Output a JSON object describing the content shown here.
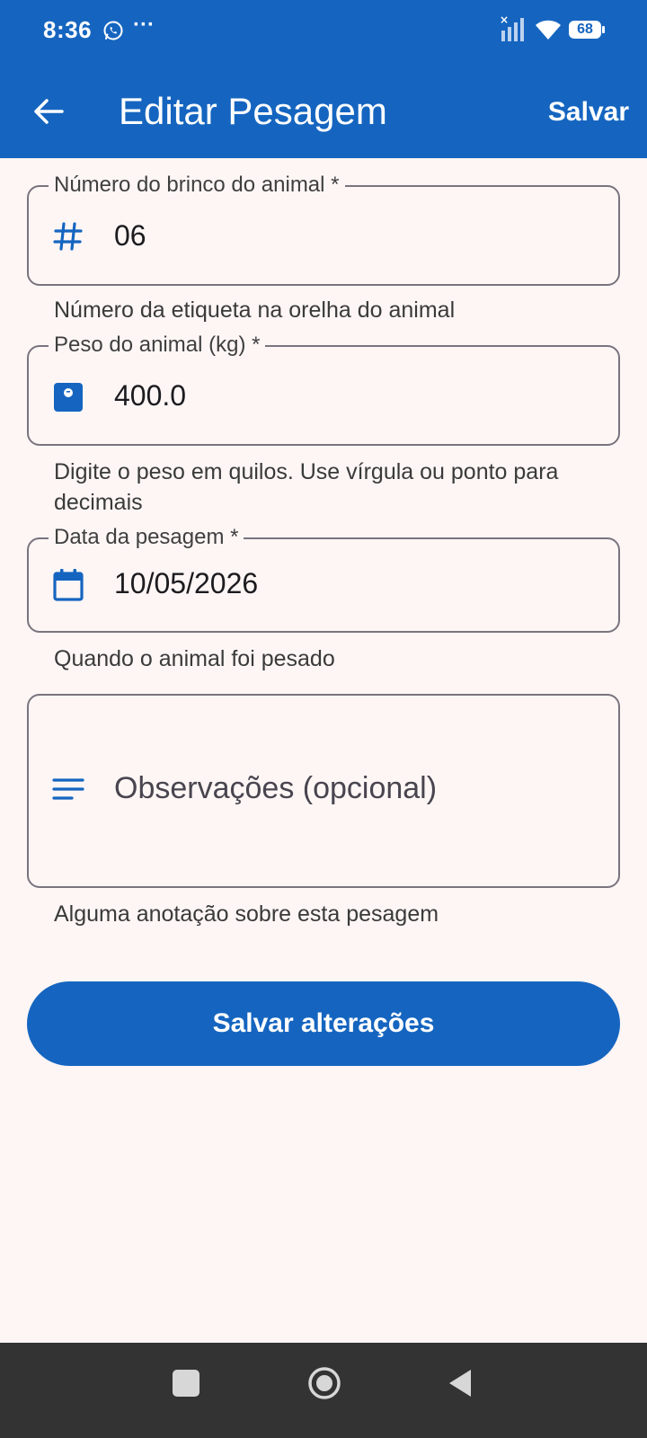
{
  "status_bar": {
    "time": "8:36",
    "more": "···",
    "battery": "68"
  },
  "app_bar": {
    "title": "Editar Pesagem",
    "save_label": "Salvar"
  },
  "form": {
    "tag_field": {
      "label": "Número do brinco do animal *",
      "value": "06",
      "helper": "Número da etiqueta na orelha do animal",
      "icon": "hash-icon"
    },
    "weight_field": {
      "label": "Peso do animal (kg) *",
      "value": "400.0",
      "helper": "Digite o peso em quilos. Use vírgula ou ponto para decimais",
      "icon": "scale-icon"
    },
    "date_field": {
      "label": "Data da pesagem *",
      "value": "10/05/2026",
      "helper": "Quando o animal foi pesado",
      "icon": "calendar-icon"
    },
    "notes_field": {
      "placeholder": "Observações (opcional)",
      "value": "",
      "helper": "Alguma anotação sobre esta pesagem",
      "icon": "notes-icon"
    }
  },
  "submit_button": {
    "label": "Salvar alterações"
  },
  "colors": {
    "primary": "#1565c0",
    "background": "#fdf6f5",
    "outline": "#79747e",
    "nav_bar": "#333333"
  }
}
